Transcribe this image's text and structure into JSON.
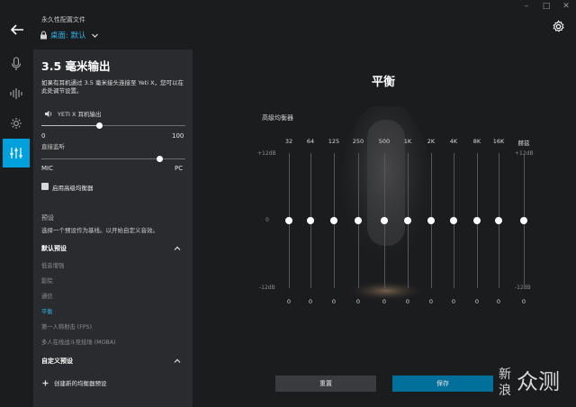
{
  "window": {
    "minimize": "–",
    "maximize": "□",
    "close": "✕"
  },
  "header": {
    "profile_caption": "永久性配置文件",
    "profile_name": "桌面: 默认"
  },
  "rail": {
    "items": [
      {
        "icon": "microphone-icon"
      },
      {
        "icon": "waveform-icon"
      },
      {
        "icon": "effects-icon"
      },
      {
        "icon": "equalizer-icon",
        "active": true
      }
    ]
  },
  "panel": {
    "title": "3.5 毫米输出",
    "description": "如果有耳机通过 3.5 毫米接头连接至 Yeti X，您可以在此处调节设置。",
    "device_label": "YETI X 耳机输出",
    "volume": {
      "min": "0",
      "max": "100",
      "value": 40
    },
    "monitor": {
      "label": "直接监听",
      "left": "MIC",
      "right": "PC",
      "value": 0.82
    },
    "enable_eq": "启用高级均衡器",
    "presets_heading": "预设",
    "presets_hint": "选择一个预设作为基线。以开始自定义音效。",
    "default_group": "默认预设",
    "presets": [
      "低音增强",
      "影院",
      "通信",
      "平衡",
      "第一人称射击 (FPS)",
      "多人在线战斗竞技场 (MOBA)"
    ],
    "active_preset": "平衡",
    "custom_group": "自定义预设",
    "add_custom": "创建新的均衡器预设"
  },
  "eq": {
    "title": "平衡",
    "caption": "高级均衡器",
    "scale_top": "+12dB",
    "scale_mid": "0",
    "scale_bottom": "-12dB",
    "range_db": [
      -12,
      12
    ],
    "bands": [
      {
        "label": "32",
        "value": "0",
        "db": 0
      },
      {
        "label": "64",
        "value": "0",
        "db": 0
      },
      {
        "label": "125",
        "value": "0",
        "db": 0
      },
      {
        "label": "250",
        "value": "0",
        "db": 0
      },
      {
        "label": "500",
        "value": "0",
        "db": 0
      },
      {
        "label": "1K",
        "value": "0",
        "db": 0
      },
      {
        "label": "2K",
        "value": "0",
        "db": 0
      },
      {
        "label": "4K",
        "value": "0",
        "db": 0
      },
      {
        "label": "8K",
        "value": "0",
        "db": 0
      },
      {
        "label": "16K",
        "value": "0",
        "db": 0
      }
    ],
    "gain": {
      "label": "赫兹",
      "value": "0",
      "db": 0
    },
    "reset_label": "重置",
    "save_label": "保存"
  },
  "watermark": {
    "line1": "新",
    "line2": "浪",
    "brand": "众测"
  },
  "colors": {
    "accent": "#00a0dc",
    "active_text": "#2fb2e8",
    "panel": "#2a2b2e",
    "background": "#1b1c1e"
  }
}
